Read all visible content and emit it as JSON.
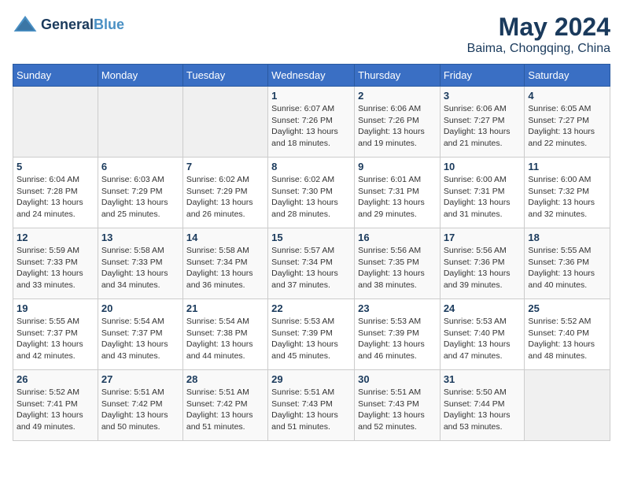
{
  "header": {
    "logo_line1": "General",
    "logo_line2": "Blue",
    "title": "May 2024",
    "subtitle": "Baima, Chongqing, China"
  },
  "weekdays": [
    "Sunday",
    "Monday",
    "Tuesday",
    "Wednesday",
    "Thursday",
    "Friday",
    "Saturday"
  ],
  "weeks": [
    [
      {
        "day": "",
        "info": ""
      },
      {
        "day": "",
        "info": ""
      },
      {
        "day": "",
        "info": ""
      },
      {
        "day": "1",
        "info": "Sunrise: 6:07 AM\nSunset: 7:26 PM\nDaylight: 13 hours\nand 18 minutes."
      },
      {
        "day": "2",
        "info": "Sunrise: 6:06 AM\nSunset: 7:26 PM\nDaylight: 13 hours\nand 19 minutes."
      },
      {
        "day": "3",
        "info": "Sunrise: 6:06 AM\nSunset: 7:27 PM\nDaylight: 13 hours\nand 21 minutes."
      },
      {
        "day": "4",
        "info": "Sunrise: 6:05 AM\nSunset: 7:27 PM\nDaylight: 13 hours\nand 22 minutes."
      }
    ],
    [
      {
        "day": "5",
        "info": "Sunrise: 6:04 AM\nSunset: 7:28 PM\nDaylight: 13 hours\nand 24 minutes."
      },
      {
        "day": "6",
        "info": "Sunrise: 6:03 AM\nSunset: 7:29 PM\nDaylight: 13 hours\nand 25 minutes."
      },
      {
        "day": "7",
        "info": "Sunrise: 6:02 AM\nSunset: 7:29 PM\nDaylight: 13 hours\nand 26 minutes."
      },
      {
        "day": "8",
        "info": "Sunrise: 6:02 AM\nSunset: 7:30 PM\nDaylight: 13 hours\nand 28 minutes."
      },
      {
        "day": "9",
        "info": "Sunrise: 6:01 AM\nSunset: 7:31 PM\nDaylight: 13 hours\nand 29 minutes."
      },
      {
        "day": "10",
        "info": "Sunrise: 6:00 AM\nSunset: 7:31 PM\nDaylight: 13 hours\nand 31 minutes."
      },
      {
        "day": "11",
        "info": "Sunrise: 6:00 AM\nSunset: 7:32 PM\nDaylight: 13 hours\nand 32 minutes."
      }
    ],
    [
      {
        "day": "12",
        "info": "Sunrise: 5:59 AM\nSunset: 7:33 PM\nDaylight: 13 hours\nand 33 minutes."
      },
      {
        "day": "13",
        "info": "Sunrise: 5:58 AM\nSunset: 7:33 PM\nDaylight: 13 hours\nand 34 minutes."
      },
      {
        "day": "14",
        "info": "Sunrise: 5:58 AM\nSunset: 7:34 PM\nDaylight: 13 hours\nand 36 minutes."
      },
      {
        "day": "15",
        "info": "Sunrise: 5:57 AM\nSunset: 7:34 PM\nDaylight: 13 hours\nand 37 minutes."
      },
      {
        "day": "16",
        "info": "Sunrise: 5:56 AM\nSunset: 7:35 PM\nDaylight: 13 hours\nand 38 minutes."
      },
      {
        "day": "17",
        "info": "Sunrise: 5:56 AM\nSunset: 7:36 PM\nDaylight: 13 hours\nand 39 minutes."
      },
      {
        "day": "18",
        "info": "Sunrise: 5:55 AM\nSunset: 7:36 PM\nDaylight: 13 hours\nand 40 minutes."
      }
    ],
    [
      {
        "day": "19",
        "info": "Sunrise: 5:55 AM\nSunset: 7:37 PM\nDaylight: 13 hours\nand 42 minutes."
      },
      {
        "day": "20",
        "info": "Sunrise: 5:54 AM\nSunset: 7:37 PM\nDaylight: 13 hours\nand 43 minutes."
      },
      {
        "day": "21",
        "info": "Sunrise: 5:54 AM\nSunset: 7:38 PM\nDaylight: 13 hours\nand 44 minutes."
      },
      {
        "day": "22",
        "info": "Sunrise: 5:53 AM\nSunset: 7:39 PM\nDaylight: 13 hours\nand 45 minutes."
      },
      {
        "day": "23",
        "info": "Sunrise: 5:53 AM\nSunset: 7:39 PM\nDaylight: 13 hours\nand 46 minutes."
      },
      {
        "day": "24",
        "info": "Sunrise: 5:53 AM\nSunset: 7:40 PM\nDaylight: 13 hours\nand 47 minutes."
      },
      {
        "day": "25",
        "info": "Sunrise: 5:52 AM\nSunset: 7:40 PM\nDaylight: 13 hours\nand 48 minutes."
      }
    ],
    [
      {
        "day": "26",
        "info": "Sunrise: 5:52 AM\nSunset: 7:41 PM\nDaylight: 13 hours\nand 49 minutes."
      },
      {
        "day": "27",
        "info": "Sunrise: 5:51 AM\nSunset: 7:42 PM\nDaylight: 13 hours\nand 50 minutes."
      },
      {
        "day": "28",
        "info": "Sunrise: 5:51 AM\nSunset: 7:42 PM\nDaylight: 13 hours\nand 51 minutes."
      },
      {
        "day": "29",
        "info": "Sunrise: 5:51 AM\nSunset: 7:43 PM\nDaylight: 13 hours\nand 51 minutes."
      },
      {
        "day": "30",
        "info": "Sunrise: 5:51 AM\nSunset: 7:43 PM\nDaylight: 13 hours\nand 52 minutes."
      },
      {
        "day": "31",
        "info": "Sunrise: 5:50 AM\nSunset: 7:44 PM\nDaylight: 13 hours\nand 53 minutes."
      },
      {
        "day": "",
        "info": ""
      }
    ]
  ]
}
